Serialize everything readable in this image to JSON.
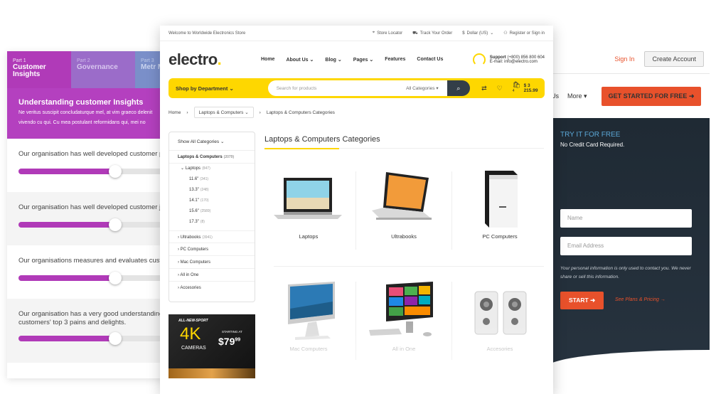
{
  "left_survey": {
    "tabs": [
      {
        "part": "Part 1",
        "name": "Customer Insights"
      },
      {
        "part": "Part 2",
        "name": "Governance"
      },
      {
        "part": "Part 3",
        "name": "Metr Mea"
      }
    ],
    "banner": {
      "heading": "Understanding customer Insights",
      "text_line1": "Ne veritus suscipit concludaturque mel, at vim graeco delenit",
      "text_line2": "vivendo cu qui. Cu mea postulant reformidans qui, mei no"
    },
    "questions": [
      {
        "text": "Our organisation has well developed customer pe",
        "text2": "",
        "value": 0.62
      },
      {
        "text": "Our organisation has well developed customer jou",
        "text2": "",
        "value": 0.62
      },
      {
        "text": "Our organisations measures and evaluates custo",
        "text2": "",
        "value": 0.62
      },
      {
        "text": "Our organisation has a very good understanding c",
        "text2": "customers' top 3 pains and delights.",
        "value": 0.62
      }
    ]
  },
  "store": {
    "topbar": {
      "welcome": "Welcome to Worldwide Electronics Store",
      "store_locator": "Store Locator",
      "track_order": "Track Your Order",
      "currency": "Dollar (US)",
      "account": "Register or Sign in"
    },
    "logo": {
      "text": "electro",
      "dot": "."
    },
    "menu": [
      "Home",
      "About Us",
      "Blog",
      "Pages",
      "Features",
      "Contact Us"
    ],
    "support": {
      "label": "Support",
      "phone": "(+800) 856 800 604",
      "email": "E-mail: info@electro.com"
    },
    "shop_by_department": "Shop by Department",
    "search": {
      "placeholder": "Search for products",
      "category": "All Categories"
    },
    "cart": {
      "count": "4",
      "total": "$ 3 215.99"
    },
    "breadcrumb": [
      "Home",
      "Laptops & Computers",
      "Laptops & Computers Categories"
    ],
    "sidebar": {
      "show_all": "Show All Categories",
      "root": {
        "label": "Laptops & Computers",
        "count": "(2079)"
      },
      "laptops": {
        "label": "Laptops",
        "count": "(847)"
      },
      "sizes": [
        {
          "label": "11.6\"",
          "count": "(341)"
        },
        {
          "label": "13.3\"",
          "count": "(248)"
        },
        {
          "label": "14.1\"",
          "count": "(170)"
        },
        {
          "label": "15.6\"",
          "count": "(2589)"
        },
        {
          "label": "17.3\"",
          "count": "(8)"
        }
      ],
      "others": [
        {
          "label": "Ultrabooks",
          "count": "(3941)"
        },
        {
          "label": "PC Computers",
          "count": ""
        },
        {
          "label": "Mac Computers",
          "count": ""
        },
        {
          "label": "All in One",
          "count": ""
        },
        {
          "label": "Accesories",
          "count": ""
        }
      ]
    },
    "promo": {
      "tag": "ALL-NEW-SPORT",
      "big": "4K",
      "sub": "CAMERAS",
      "starting": "STARTING AT",
      "price": "$79",
      "cents": "99"
    },
    "categories_title": "Laptops & Computers Categories",
    "categories": [
      "Laptops",
      "Ultrabooks",
      "PC Computers",
      "Mac Computers",
      "All in One",
      "Accesories"
    ]
  },
  "right_panel": {
    "sign_in": "Sign In",
    "create_account": "Create Account",
    "nav": [
      "t Us",
      "More"
    ],
    "cta": "GET STARTED FOR FREE",
    "try_free": "TRY IT FOR FREE",
    "no_card": "No Credit Card Required.",
    "name_placeholder": "Name",
    "email_placeholder": "Email Address",
    "note": "Your personal information is only used to contact you. We never share or sell this information.",
    "start": "START",
    "plans_link": "See Plans & Pricing"
  },
  "colors": {
    "accent_yellow": "#fed700",
    "purple": "#b03ab8",
    "orange": "#e8512b",
    "dark": "#333e48"
  }
}
